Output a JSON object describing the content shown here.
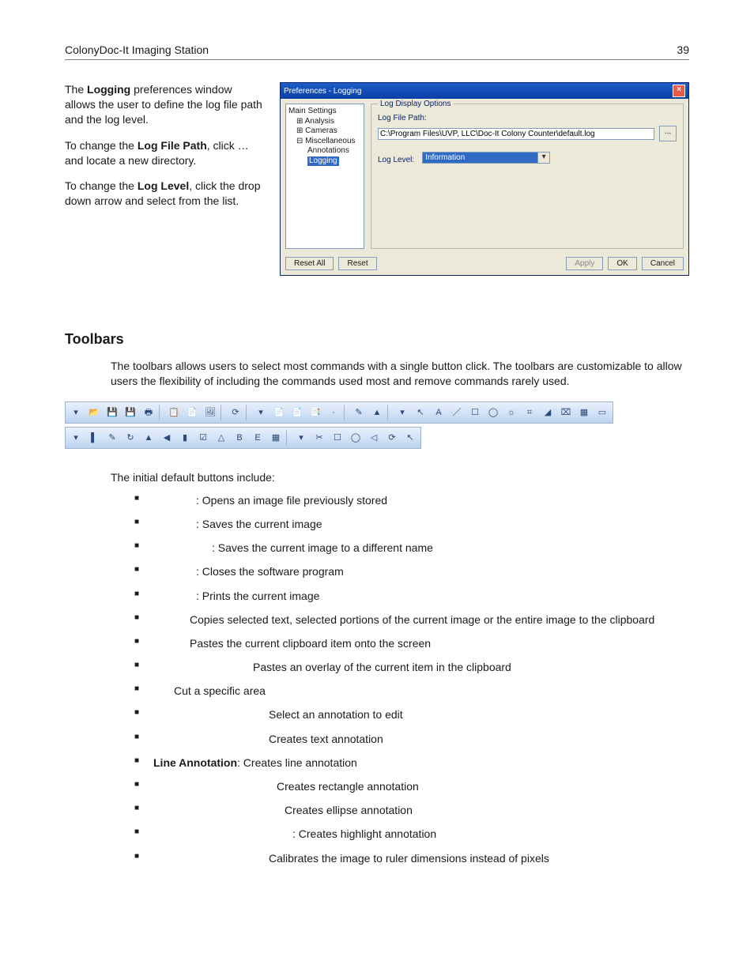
{
  "header": {
    "title": "ColonyDoc-It Imaging Station",
    "page": "39"
  },
  "intro": {
    "p1_before": "The ",
    "p1_b": "Logging",
    "p1_after": " preferences window allows the user to define the log file path and the log level.",
    "p2_before": "To change the ",
    "p2_b": "Log File Path",
    "p2_after": ", click … and locate a new directory.",
    "p3_before": "To change the ",
    "p3_b": "Log Level",
    "p3_after": ", click the drop down arrow and select from the list."
  },
  "win": {
    "title": "Preferences - Logging",
    "tree": {
      "root": "Main Settings",
      "a": "Analysis",
      "b": "Cameras",
      "c": "Miscellaneous",
      "d": "Annotations",
      "sel": "Logging"
    },
    "group": "Log Display Options",
    "lfp_label": "Log File Path:",
    "lfp_value": "C:\\Program Files\\UVP, LLC\\Doc-It Colony Counter\\default.log",
    "dots": "...",
    "ll_label": "Log Level:",
    "ll_value": "Information",
    "btn_resetall": "Reset All",
    "btn_reset": "Reset",
    "btn_apply": "Apply",
    "btn_ok": "OK",
    "btn_cancel": "Cancel"
  },
  "section_heading": "Toolbars",
  "para_toolbars": "The toolbars allows users to select most commands with a single button click.  The toolbars are customizable to allow users the flexibility of including the commands used most and remove commands rarely used.",
  "initial_label": "The initial default buttons include:",
  "bullets": [
    ": Opens an image file previously stored",
    ": Saves the current image",
    ": Saves the current image to a different name",
    ": Closes the software program",
    ": Prints the current image",
    "Copies selected text, selected portions of the current image or the entire image to the clipboard",
    "Pastes the current clipboard item onto the screen",
    "Pastes an overlay of the current item in the clipboard",
    "Cut a specific area",
    "Select an annotation to edit",
    "Creates text annotation"
  ],
  "bullet_line_b": "Line Annotation",
  "bullet_line_rest": ": Creates line annotation",
  "bullets2": [
    "Creates rectangle annotation",
    "Creates ellipse annotation",
    ": Creates highlight annotation",
    "Calibrates the image to ruler dimensions instead of pixels"
  ],
  "icons_row1": [
    "▾",
    "📂",
    "💾",
    "💾",
    "🖶",
    "|",
    "📋",
    "📄",
    "🖼",
    "|",
    "⟳",
    "|",
    "▾",
    "📄",
    "📄",
    "📑",
    "·",
    "|",
    "✎",
    "▲",
    "|",
    "▾",
    "↖",
    "A",
    "／",
    "☐",
    "◯",
    "☼",
    "⌗",
    "◢",
    "⌧",
    "▦",
    "▭"
  ],
  "icons_row2": [
    "▾",
    "▌",
    "✎",
    "↻",
    "▲",
    "◀",
    "▮",
    "☑",
    "△",
    "B",
    "E",
    "▦",
    "|",
    "▾",
    "✂",
    "☐",
    "◯",
    "◁",
    "⟳",
    "↖"
  ]
}
